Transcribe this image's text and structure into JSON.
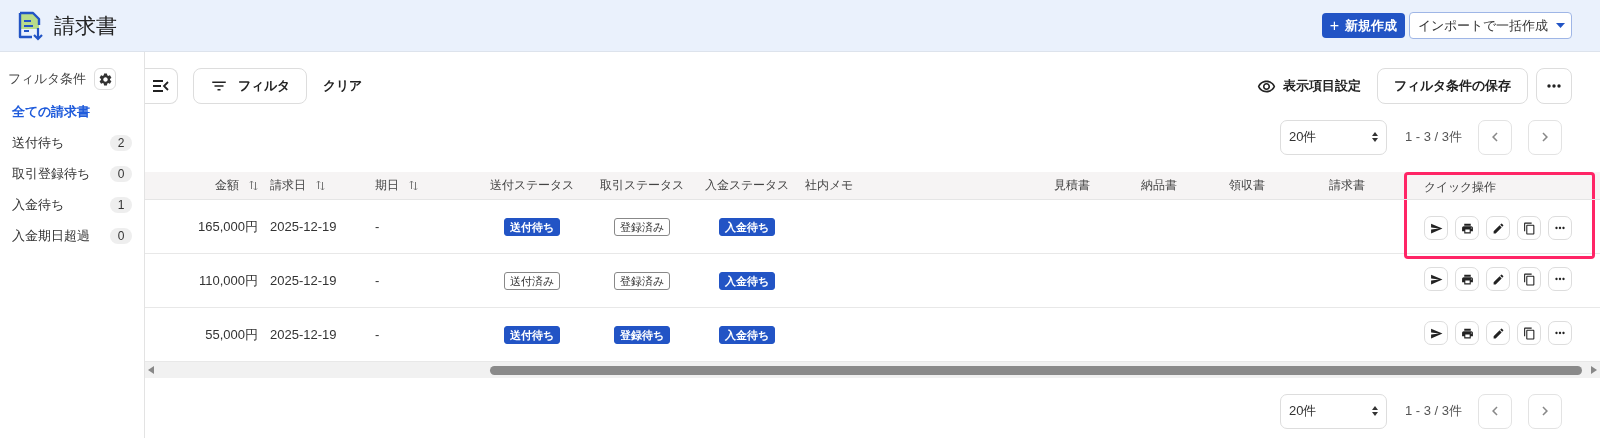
{
  "header": {
    "title": "請求書",
    "new_button": "新規作成",
    "new_button_icon": "+",
    "import_dropdown": "インポートで一括作成"
  },
  "sidebar": {
    "title": "フィルタ条件",
    "items": [
      {
        "label": "全ての請求書",
        "selected": true
      },
      {
        "label": "送付待ち",
        "count": "2",
        "selected": false
      },
      {
        "label": "取引登録待ち",
        "count": "0",
        "selected": false
      },
      {
        "label": "入金待ち",
        "count": "1",
        "selected": false
      },
      {
        "label": "入金期日超過",
        "count": "0",
        "selected": false
      }
    ]
  },
  "toolbar": {
    "filter_button": "フィルタ",
    "clear_link": "クリア",
    "columns_setting": "表示項目設定",
    "save_filter_button": "フィルタ条件の保存"
  },
  "pagination_top": {
    "page_size": "20件",
    "range": "1 - 3 / 3件"
  },
  "table": {
    "columns": [
      {
        "label": "金額",
        "sortable": true,
        "highlighted": false
      },
      {
        "label": "請求日",
        "sortable": true,
        "highlighted": false
      },
      {
        "label": "期日",
        "sortable": true,
        "highlighted": false
      },
      {
        "label": "送付ステータス",
        "sortable": false,
        "highlighted": false
      },
      {
        "label": "取引ステータス",
        "sortable": false,
        "highlighted": false
      },
      {
        "label": "入金ステータス",
        "sortable": false,
        "highlighted": false
      },
      {
        "label": "社内メモ",
        "sortable": false,
        "highlighted": false
      },
      {
        "label": "見積書",
        "sortable": false,
        "highlighted": false
      },
      {
        "label": "納品書",
        "sortable": false,
        "highlighted": false
      },
      {
        "label": "領収書",
        "sortable": false,
        "highlighted": false
      },
      {
        "label": "請求書",
        "sortable": false,
        "highlighted": false
      },
      {
        "label": "クイック操作",
        "sortable": false,
        "highlighted": true
      }
    ],
    "rows": [
      {
        "amount": "165,000円",
        "date": "2025-12-19",
        "due": "-",
        "send_status": {
          "label": "送付待ち",
          "kind": "filled"
        },
        "deal_status": {
          "label": "登録済み",
          "kind": "outline"
        },
        "payment_status": {
          "label": "入金待ち",
          "kind": "filled"
        },
        "highlighted": true
      },
      {
        "amount": "110,000円",
        "date": "2025-12-19",
        "due": "-",
        "send_status": {
          "label": "送付済み",
          "kind": "outline"
        },
        "deal_status": {
          "label": "登録済み",
          "kind": "outline"
        },
        "payment_status": {
          "label": "入金待ち",
          "kind": "filled"
        },
        "highlighted": false
      },
      {
        "amount": "55,000円",
        "date": "2025-12-19",
        "due": "-",
        "send_status": {
          "label": "送付待ち",
          "kind": "filled"
        },
        "deal_status": {
          "label": "登録待ち",
          "kind": "filled"
        },
        "payment_status": {
          "label": "入金待ち",
          "kind": "filled"
        },
        "highlighted": false
      }
    ]
  },
  "pagination_bottom": {
    "page_size": "20件",
    "range": "1 - 3 / 3件"
  }
}
